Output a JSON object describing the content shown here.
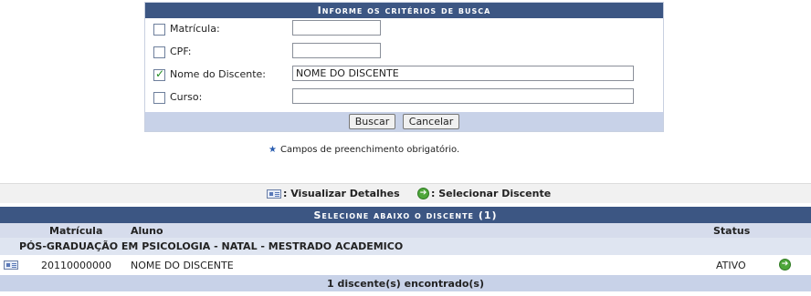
{
  "form": {
    "caption": "Informe os critérios de busca",
    "fields": [
      {
        "label": "Matrícula:",
        "checked": false,
        "value": ""
      },
      {
        "label": "CPF:",
        "checked": false,
        "value": ""
      },
      {
        "label": "Nome do Discente:",
        "checked": true,
        "value": "NOME DO DISCENTE"
      },
      {
        "label": "Curso:",
        "checked": false,
        "value": ""
      }
    ],
    "buttons": {
      "search": "Buscar",
      "cancel": "Cancelar"
    },
    "required_note": "Campos de preenchimento obrigatório."
  },
  "legend": {
    "view_details": ": Visualizar Detalhes",
    "select_student": ": Selecionar Discente"
  },
  "results": {
    "caption": "Selecione abaixo o discente (1)",
    "columns": {
      "matricula": "Matrícula",
      "aluno": "Aluno",
      "status": "Status"
    },
    "group": "PÓS-GRADUAÇÃO EM PSICOLOGIA - NATAL - MESTRADO ACADEMICO",
    "rows": [
      {
        "matricula": "20110000000",
        "aluno": "NOME DO DISCENTE",
        "status": "ATIVO"
      }
    ],
    "footer": "1 discente(s) encontrado(s)"
  }
}
